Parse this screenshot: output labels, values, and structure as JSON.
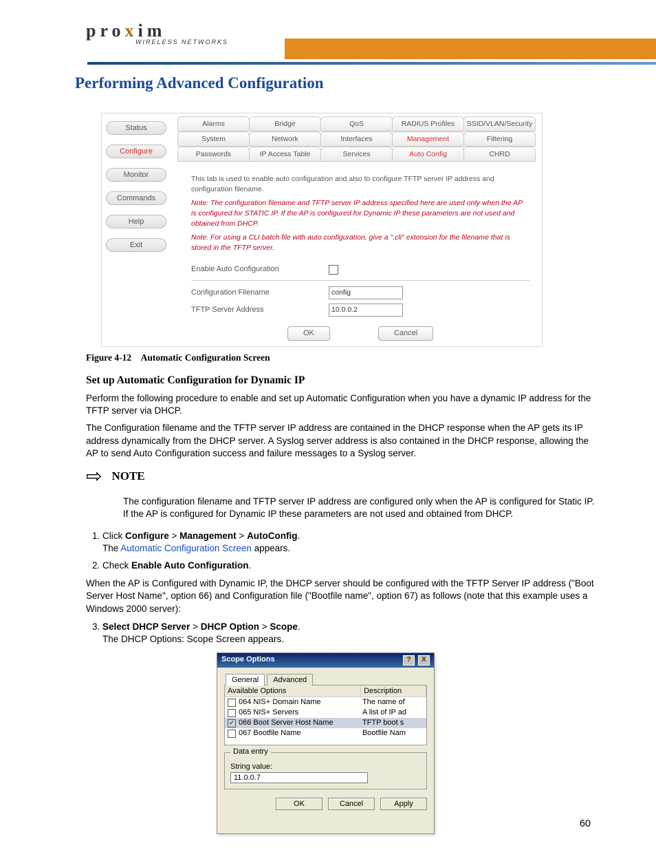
{
  "logo": {
    "text_pre": "pro",
    "text_x": "x",
    "text_post": "im",
    "sub": "WIRELESS NETWORKS"
  },
  "heading": "Performing Advanced Configuration",
  "shot1": {
    "side_nav": [
      "Status",
      "Configure",
      "Monitor",
      "Commands",
      "Help",
      "Exit"
    ],
    "side_nav_active_index": 1,
    "tabs_row1": [
      "Alarms",
      "Bridge",
      "QoS",
      "RADIUS Profiles",
      "SSID/VLAN/Security"
    ],
    "tabs_row2": [
      "System",
      "Network",
      "Interfaces",
      "Management",
      "Filtering"
    ],
    "tabs_row2_sel_index": 3,
    "tabs_row3": [
      "Passwords",
      "IP Access Table",
      "Services",
      "Auto Config",
      "CHRD"
    ],
    "tabs_row3_sel_index": 3,
    "desc": "This tab is used to enable auto configuration and also to configure TFTP server IP address and configuration filename.",
    "note1": "Note: The configuration filename and TFTP server IP address specified here are used only when the AP is configured for STATIC IP. If the AP is configured for Dynamic IP these parameters are not used and obtained from DHCP.",
    "note2": "Note: For using a CLI batch file with auto configuration, give a \".cli\" extension for the filename that is stored in the TFTP server.",
    "enable_label": "Enable Auto Configuration",
    "cfg_filename_label": "Configuration Filename",
    "cfg_filename_value": "config",
    "tftp_label": "TFTP Server Address",
    "tftp_value": "10.0.0.2",
    "ok": "OK",
    "cancel": "Cancel"
  },
  "fig_caption": "Figure 4-12 Automatic Configuration Screen",
  "h3": "Set up Automatic Configuration for Dynamic IP",
  "para1": "Perform the following procedure to enable and set up Automatic Configuration when you have a dynamic IP address for the TFTP server via DHCP.",
  "para2": "The Configuration filename and the TFTP server IP address are contained in the DHCP response when the AP gets its IP address dynamically from the DHCP server. A Syslog server address is also contained in the DHCP response, allowing the AP to send Auto Configuration success and failure messages to a Syslog server.",
  "note_label": "NOTE",
  "note_body": "The configuration filename and TFTP server IP address are configured only when the AP is configured for Static IP. If the AP is configured for Dynamic IP these parameters are not used and obtained from DHCP.",
  "step1": {
    "pre": "Click ",
    "b1": "Configure",
    "s1": " > ",
    "b2": "Management",
    "s2": " > ",
    "b3": "AutoConfig",
    "post": ".",
    "line2_pre": "The ",
    "link": "Automatic Configuration Screen",
    "line2_post": " appears."
  },
  "step2": {
    "pre": "Check ",
    "b": "Enable Auto Configuration",
    "post": "."
  },
  "para3": "When the AP is Configured with Dynamic IP, the DHCP server should be configured with the TFTP Server IP address (\"Boot Server Host Name\", option 66) and Configuration file (\"Bootfile name\", option 67) as follows (note that this example uses a Windows 2000 server):",
  "step3": {
    "b1": "Select DHCP Server",
    "s1": " > ",
    "b2": "DHCP Option",
    "s2": " > ",
    "b3": "Scope",
    "post": ".",
    "line2": "The DHCP Options: Scope Screen appears."
  },
  "shot2": {
    "title": "Scope Options",
    "tab_general": "General",
    "tab_advanced": "Advanced",
    "col_options": "Available Options",
    "col_desc": "Description",
    "rows": [
      {
        "chk": false,
        "name": "064 NIS+ Domain Name",
        "desc": "The name of"
      },
      {
        "chk": false,
        "name": "065 NIS+ Servers",
        "desc": "A list of IP ad"
      },
      {
        "chk": true,
        "name": "066 Boot Server Host Name",
        "desc": "TFTP boot s"
      },
      {
        "chk": false,
        "name": "067 Bootfile Name",
        "desc": "Bootfile Nam"
      }
    ],
    "data_entry_legend": "Data entry",
    "string_label": "String value:",
    "string_value": "11.0.0.7",
    "ok": "OK",
    "cancel": "Cancel",
    "apply": "Apply",
    "help_icon": "?",
    "close_icon": "X"
  },
  "page_number": "60"
}
